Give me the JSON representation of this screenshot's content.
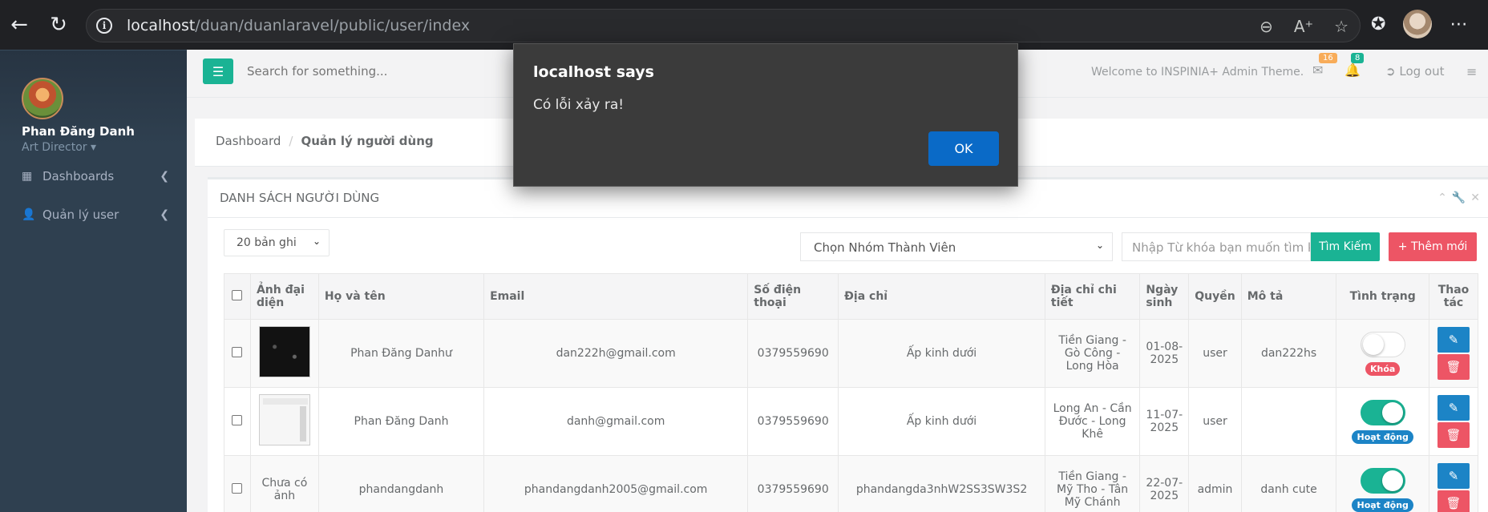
{
  "browser": {
    "url_host": "localhost",
    "url_path": "/duan/duanlaravel/public/user/index"
  },
  "sidebar": {
    "user_name": "Phan Đăng Danh",
    "user_role": "Art Director",
    "items": [
      {
        "label": "Dashboards",
        "icon": "grid-icon"
      },
      {
        "label": "Quản lý user",
        "icon": "user-icon"
      }
    ]
  },
  "topbar": {
    "search_placeholder": "Search for something...",
    "welcome": "Welcome to INSPINIA+ Admin Theme.",
    "mail_count": "16",
    "bell_count": "8",
    "logout": "Log out",
    "colors": {
      "mail_badge": "#f8ac59",
      "bell_badge": "#1ab394"
    }
  },
  "breadcrumb": {
    "home": "Dashboard",
    "current": "Quản lý người dùng"
  },
  "panel": {
    "title": "DANH SÁCH NGƯỜI DÙNG",
    "per_page": "20 bản ghi",
    "group_select": "Chọn Nhóm Thành Viên",
    "search_placeholder": "Nhập Từ khóa bạn muốn tìm k",
    "search_button": "Tìm Kiếm",
    "add_button": "Thêm mới"
  },
  "table": {
    "headers": {
      "avatar": "Ảnh đại diện",
      "name": "Họ và tên",
      "email": "Email",
      "phone": "Số điện thoại",
      "address": "Địa chỉ",
      "address_detail": "Địa chỉ chi tiết",
      "birthday": "Ngày sinh",
      "role": "Quyền",
      "desc": "Mô tả",
      "status": "Tình trạng",
      "actions": "Thao tác"
    },
    "rows": [
      {
        "avatar_text": "",
        "name": "Phan Đăng Danhư",
        "email": "dan222h@gmail.com",
        "phone": "0379559690",
        "address": "Ấp kinh dưới",
        "address_detail": "Tiền Giang - Gò Công - Long Hòa",
        "birthday": "01-08-2025",
        "role": "user",
        "desc": "dan222hs",
        "status": "Khóa"
      },
      {
        "avatar_text": "",
        "name": "Phan Đăng Danh",
        "email": "danh@gmail.com",
        "phone": "0379559690",
        "address": "Ấp kinh dưới",
        "address_detail": "Long An - Cần Đước - Long Khê",
        "birthday": "11-07-2025",
        "role": "user",
        "desc": "",
        "status": "Hoạt động"
      },
      {
        "avatar_text": "Chưa có ảnh",
        "name": "phandangdanh",
        "email": "phandangdanh2005@gmail.com",
        "phone": "0379559690",
        "address": "phandangda3nhW2SS3SW3S2",
        "address_detail": "Tiền Giang - Mỹ Tho - Tân Mỹ Chánh",
        "birthday": "22-07-2025",
        "role": "admin",
        "desc": "danh cute",
        "status": "Hoạt động"
      }
    ]
  },
  "dialog": {
    "title": "localhost says",
    "message": "Có lỗi xảy ra!",
    "ok": "OK"
  }
}
